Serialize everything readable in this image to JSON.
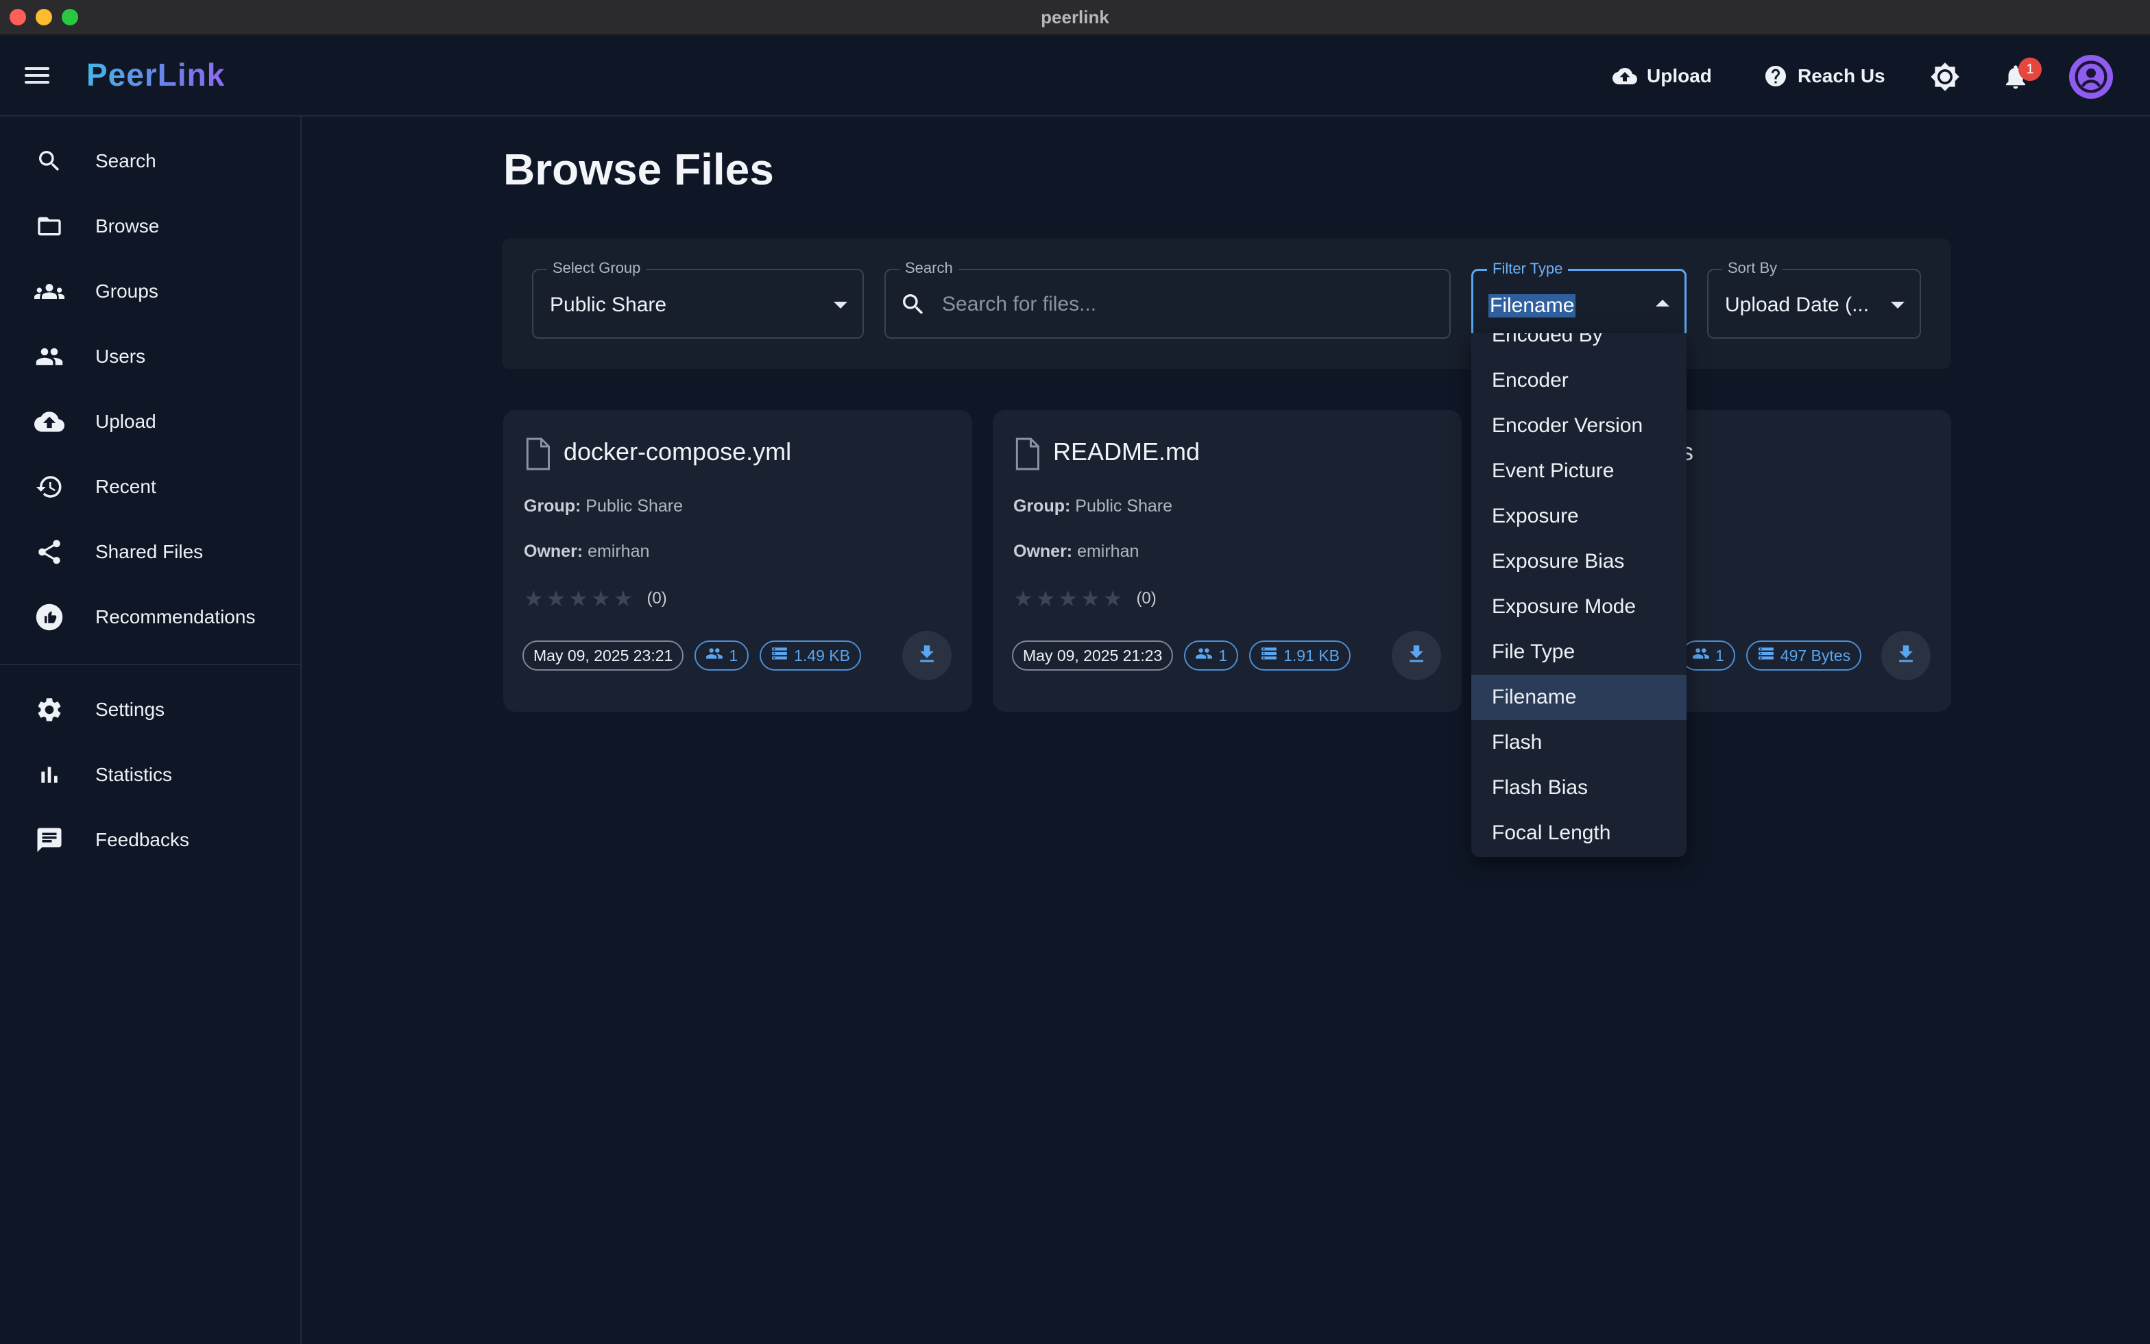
{
  "window": {
    "title": "peerlink"
  },
  "app": {
    "brand": "PeerLink"
  },
  "topbar": {
    "upload_label": "Upload",
    "reach_label": "Reach Us",
    "notification_count": "1"
  },
  "sidebar": {
    "items": [
      {
        "label": "Search",
        "icon": "search-icon"
      },
      {
        "label": "Browse",
        "icon": "folder-icon"
      },
      {
        "label": "Groups",
        "icon": "groups-icon"
      },
      {
        "label": "Users",
        "icon": "users-icon"
      },
      {
        "label": "Upload",
        "icon": "cloud-upload-icon"
      },
      {
        "label": "Recent",
        "icon": "history-icon"
      },
      {
        "label": "Shared Files",
        "icon": "share-icon"
      },
      {
        "label": "Recommendations",
        "icon": "thumb-up-icon"
      },
      {
        "label": "Settings",
        "icon": "gear-icon"
      },
      {
        "label": "Statistics",
        "icon": "bar-chart-icon"
      },
      {
        "label": "Feedbacks",
        "icon": "feedback-icon"
      }
    ]
  },
  "page": {
    "title": "Browse Files"
  },
  "filters": {
    "group": {
      "legend": "Select Group",
      "value": "Public Share"
    },
    "search": {
      "legend": "Search",
      "placeholder": "Search for files..."
    },
    "filter_type": {
      "legend": "Filter Type",
      "value": "Filename"
    },
    "sort": {
      "legend": "Sort By",
      "value": "Upload Date (..."
    }
  },
  "cards": [
    {
      "filename": "docker-compose.yml",
      "group_label": "Group:",
      "group": "Public Share",
      "owner_label": "Owner:",
      "owner": "emirhan",
      "rating": 0,
      "rating_count": "(0)",
      "date": "May 09, 2025 23:21",
      "users": "1",
      "size": "1.49 KB"
    },
    {
      "filename": "README.md",
      "group_label": "Group:",
      "group": "Public Share",
      "owner_label": "Owner:",
      "owner": "emirhan",
      "rating": 0,
      "rating_count": "(0)",
      "date": "May 09, 2025 21:23",
      "users": "1",
      "size": "1.91 KB"
    },
    {
      "filename": "s",
      "users": "1",
      "size": "497 Bytes"
    }
  ],
  "dropdown": {
    "options": [
      "Encoded By",
      "Encoder",
      "Encoder Version",
      "Event Picture",
      "Exposure",
      "Exposure Bias",
      "Exposure Mode",
      "File Type",
      "Filename",
      "Flash",
      "Flash Bias",
      "Focal Length"
    ],
    "selected": "Filename"
  },
  "colors": {
    "background": "#0f1726",
    "card": "#1a2130",
    "accent": "#5aa6f0",
    "badge": "#e5473f",
    "avatar": "#8f5cf0"
  }
}
